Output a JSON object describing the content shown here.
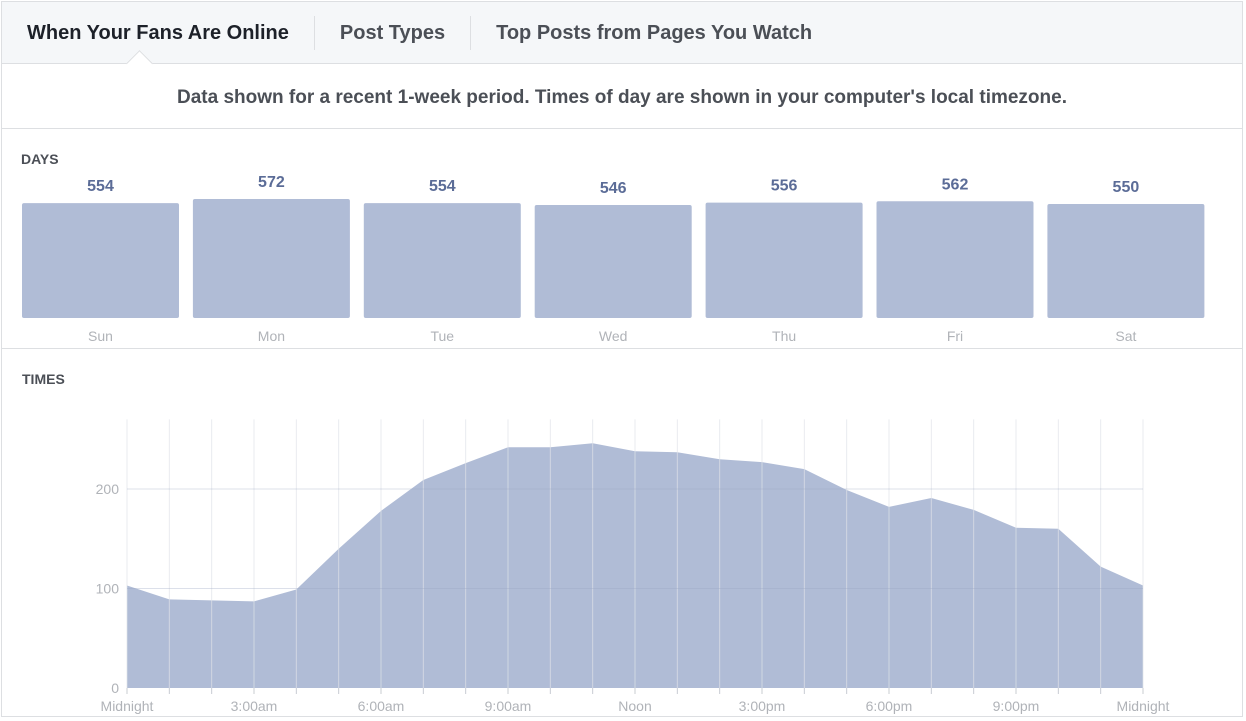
{
  "tabs": [
    {
      "label": "When Your Fans Are Online",
      "active": true
    },
    {
      "label": "Post Types",
      "active": false
    },
    {
      "label": "Top Posts from Pages You Watch",
      "active": false
    }
  ],
  "notice": "Data shown for a recent 1-week period. Times of day are shown in your computer's local timezone.",
  "days_section": {
    "title": "DAYS"
  },
  "times_section": {
    "title": "TIMES"
  },
  "colors": {
    "bar": "#b0bcd6",
    "value_label": "#5b6c97",
    "axis_label": "#b0b3b8",
    "grid": "#eceef1"
  },
  "chart_data": [
    {
      "type": "bar",
      "title": "DAYS",
      "categories": [
        "Sun",
        "Mon",
        "Tue",
        "Wed",
        "Thu",
        "Fri",
        "Sat"
      ],
      "values": [
        554,
        572,
        554,
        546,
        556,
        562,
        550
      ],
      "data_labels": true,
      "xlabel": "",
      "ylabel": ""
    },
    {
      "type": "area",
      "title": "TIMES",
      "x": [
        "Midnight",
        "1am",
        "2am",
        "3:00am",
        "4am",
        "5am",
        "6:00am",
        "7am",
        "8am",
        "9:00am",
        "10am",
        "11am",
        "Noon",
        "1pm",
        "2pm",
        "3:00pm",
        "4pm",
        "5pm",
        "6:00pm",
        "7pm",
        "8pm",
        "9:00pm",
        "10pm",
        "11pm",
        "Midnight"
      ],
      "values": [
        103,
        89,
        88,
        87,
        99,
        140,
        178,
        209,
        226,
        242,
        242,
        246,
        238,
        237,
        230,
        227,
        220,
        199,
        182,
        191,
        179,
        161,
        160,
        122,
        103
      ],
      "x_tick_labels": [
        "Midnight",
        "3:00am",
        "6:00am",
        "9:00am",
        "Noon",
        "3:00pm",
        "6:00pm",
        "9:00pm",
        "Midnight"
      ],
      "y_tick_labels": [
        "0",
        "100",
        "200"
      ],
      "ylim": [
        0,
        270
      ],
      "grid": true,
      "xlabel": "",
      "ylabel": ""
    }
  ]
}
